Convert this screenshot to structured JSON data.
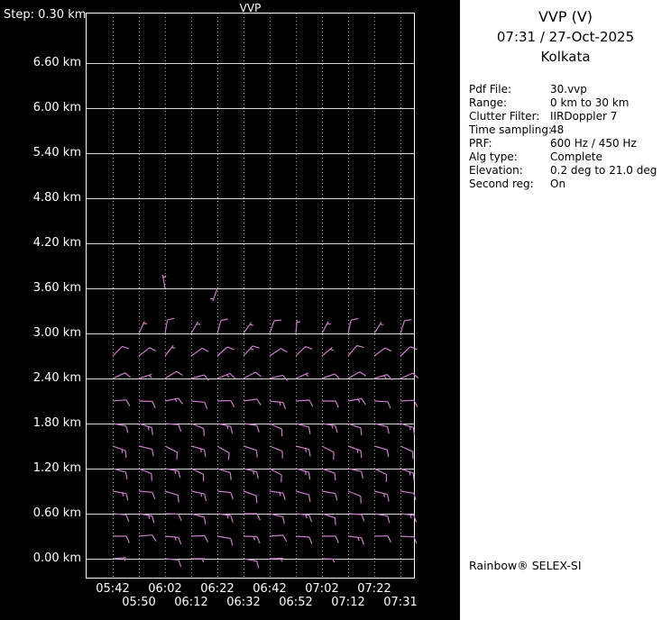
{
  "colors": {
    "background": "#000000",
    "panel_background": "#ffffff",
    "grid_solid": "#d8d8d8",
    "grid_dotted": "#909090",
    "border": "#ffffff",
    "barb": "#cd7ccd",
    "text_plot": "#ffffff",
    "text_panel": "#000000"
  },
  "chart": {
    "type": "wind-barb-time-height",
    "title": "VVP",
    "step_label": "Step: 0.30 km",
    "y_labels": [
      "6.60 km",
      "6.00 km",
      "5.40 km",
      "4.80 km",
      "4.20 km",
      "3.60 km",
      "3.00 km",
      "2.40 km",
      "1.80 km",
      "1.20 km",
      "0.60 km",
      "0.00 km"
    ],
    "y_alts": [
      6.6,
      6.0,
      5.4,
      4.8,
      4.2,
      3.6,
      3.0,
      2.4,
      1.8,
      1.2,
      0.6,
      0.0
    ],
    "x_ticks": [
      "05:42",
      "05:50",
      "06:02",
      "06:12",
      "06:22",
      "06:32",
      "06:42",
      "06:52",
      "07:02",
      "07:12",
      "07:22",
      "07:31"
    ],
    "barbs": [
      {
        "alt": 3.6,
        "cols": [
          2,
          4
        ],
        "dirs": [
          350,
          200
        ],
        "spds": [
          5,
          5
        ]
      },
      {
        "alt": 3.0,
        "cols": [
          1,
          2,
          3,
          4,
          5,
          6,
          7,
          8,
          9,
          10,
          11
        ],
        "dirs": [
          25,
          10,
          30,
          15,
          35,
          20,
          5,
          28,
          12,
          32,
          18
        ],
        "spds": [
          5,
          10,
          5,
          10,
          5,
          10,
          5,
          5,
          10,
          5,
          10
        ]
      },
      {
        "alt": 2.7,
        "cols": [
          0,
          1,
          2,
          3,
          4,
          5,
          6,
          7,
          8,
          9,
          10,
          11
        ],
        "dirs": [
          45,
          52,
          38,
          55,
          48,
          42,
          56,
          46,
          50,
          40,
          53,
          47
        ],
        "spds": [
          10,
          10,
          5,
          10,
          10,
          15,
          10,
          10,
          5,
          10,
          10,
          10
        ]
      },
      {
        "alt": 2.4,
        "cols": [
          0,
          1,
          2,
          3,
          4,
          5,
          6,
          7,
          8,
          9,
          10,
          11
        ],
        "dirs": [
          65,
          72,
          58,
          75,
          68,
          62,
          76,
          66,
          70,
          60,
          73,
          67
        ],
        "spds": [
          10,
          5,
          10,
          10,
          15,
          10,
          10,
          5,
          10,
          10,
          15,
          10
        ]
      },
      {
        "alt": 2.1,
        "cols": [
          0,
          1,
          2,
          3,
          4,
          5,
          6,
          7,
          8,
          9,
          10,
          11
        ],
        "dirs": [
          85,
          92,
          78,
          95,
          88,
          82,
          96,
          86,
          90,
          80,
          93,
          87
        ],
        "spds": [
          10,
          10,
          15,
          10,
          10,
          10,
          15,
          10,
          10,
          15,
          10,
          10
        ]
      },
      {
        "alt": 1.8,
        "cols": [
          0,
          1,
          2,
          3,
          4,
          5,
          6,
          7,
          8,
          9,
          10,
          11
        ],
        "dirs": [
          100,
          108,
          95,
          112,
          102,
          98,
          115,
          105,
          99,
          110,
          103,
          107
        ],
        "spds": [
          10,
          15,
          10,
          10,
          15,
          10,
          10,
          10,
          15,
          10,
          10,
          15
        ]
      },
      {
        "alt": 1.5,
        "cols": [
          0,
          1,
          2,
          3,
          4,
          5,
          6,
          7,
          8,
          9,
          10,
          11
        ],
        "dirs": [
          110,
          103,
          117,
          105,
          120,
          108,
          112,
          104,
          118,
          110,
          106,
          114
        ],
        "spds": [
          15,
          10,
          10,
          15,
          10,
          10,
          10,
          15,
          10,
          15,
          10,
          10
        ]
      },
      {
        "alt": 1.2,
        "cols": [
          0,
          1,
          2,
          3,
          4,
          5,
          6,
          7,
          8,
          9,
          10,
          11
        ],
        "dirs": [
          105,
          112,
          100,
          115,
          108,
          103,
          118,
          106,
          110,
          102,
          116,
          109
        ],
        "spds": [
          10,
          10,
          15,
          10,
          10,
          15,
          10,
          15,
          10,
          10,
          10,
          15
        ]
      },
      {
        "alt": 0.9,
        "cols": [
          0,
          1,
          2,
          3,
          4,
          5,
          6,
          7,
          8,
          9,
          10,
          11
        ],
        "dirs": [
          100,
          95,
          108,
          102,
          96,
          110,
          98,
          105,
          100,
          112,
          104,
          99
        ],
        "spds": [
          15,
          10,
          10,
          15,
          10,
          10,
          15,
          10,
          10,
          10,
          15,
          10
        ]
      },
      {
        "alt": 0.6,
        "cols": [
          0,
          1,
          2,
          3,
          4,
          5,
          6,
          7,
          8,
          9,
          10,
          11
        ],
        "dirs": [
          95,
          100,
          92,
          105,
          98,
          90,
          103,
          96,
          108,
          94,
          100,
          97
        ],
        "spds": [
          10,
          15,
          10,
          10,
          15,
          10,
          10,
          15,
          10,
          10,
          10,
          15
        ]
      },
      {
        "alt": 0.3,
        "cols": [
          0,
          1,
          2,
          3,
          4,
          5,
          6,
          7,
          8,
          9,
          10,
          11
        ],
        "dirs": [
          90,
          85,
          95,
          88,
          100,
          92,
          86,
          94,
          90,
          97,
          89,
          93
        ],
        "spds": [
          10,
          10,
          15,
          10,
          10,
          15,
          10,
          10,
          10,
          15,
          10,
          10
        ]
      },
      {
        "alt": 0.0,
        "cols": [
          0,
          2,
          3,
          5,
          6,
          8
        ],
        "dirs": [
          85,
          95,
          90,
          100,
          88,
          92
        ],
        "spds": [
          5,
          10,
          5,
          10,
          5,
          5
        ]
      }
    ]
  },
  "info_panel": {
    "title": "VVP (V)",
    "datetime": "07:31 / 27-Oct-2025",
    "site": "Kolkata",
    "fields": [
      {
        "label": "Pdf File:",
        "value": "30.vvp"
      },
      {
        "label": "Range:",
        "value": "0 km to 30 km"
      },
      {
        "label": "Clutter Filter:",
        "value": "IIRDoppler 7"
      },
      {
        "label": "Time sampling:",
        "value": "48"
      },
      {
        "label": "PRF:",
        "value": "600 Hz / 450 Hz"
      },
      {
        "label": "Alg type:",
        "value": "Complete"
      },
      {
        "label": "Elevation:",
        "value": "0.2 deg to 21.0 deg"
      },
      {
        "label": "Second reg:",
        "value": "On"
      }
    ],
    "footer": "Rainbow® SELEX-SI"
  }
}
